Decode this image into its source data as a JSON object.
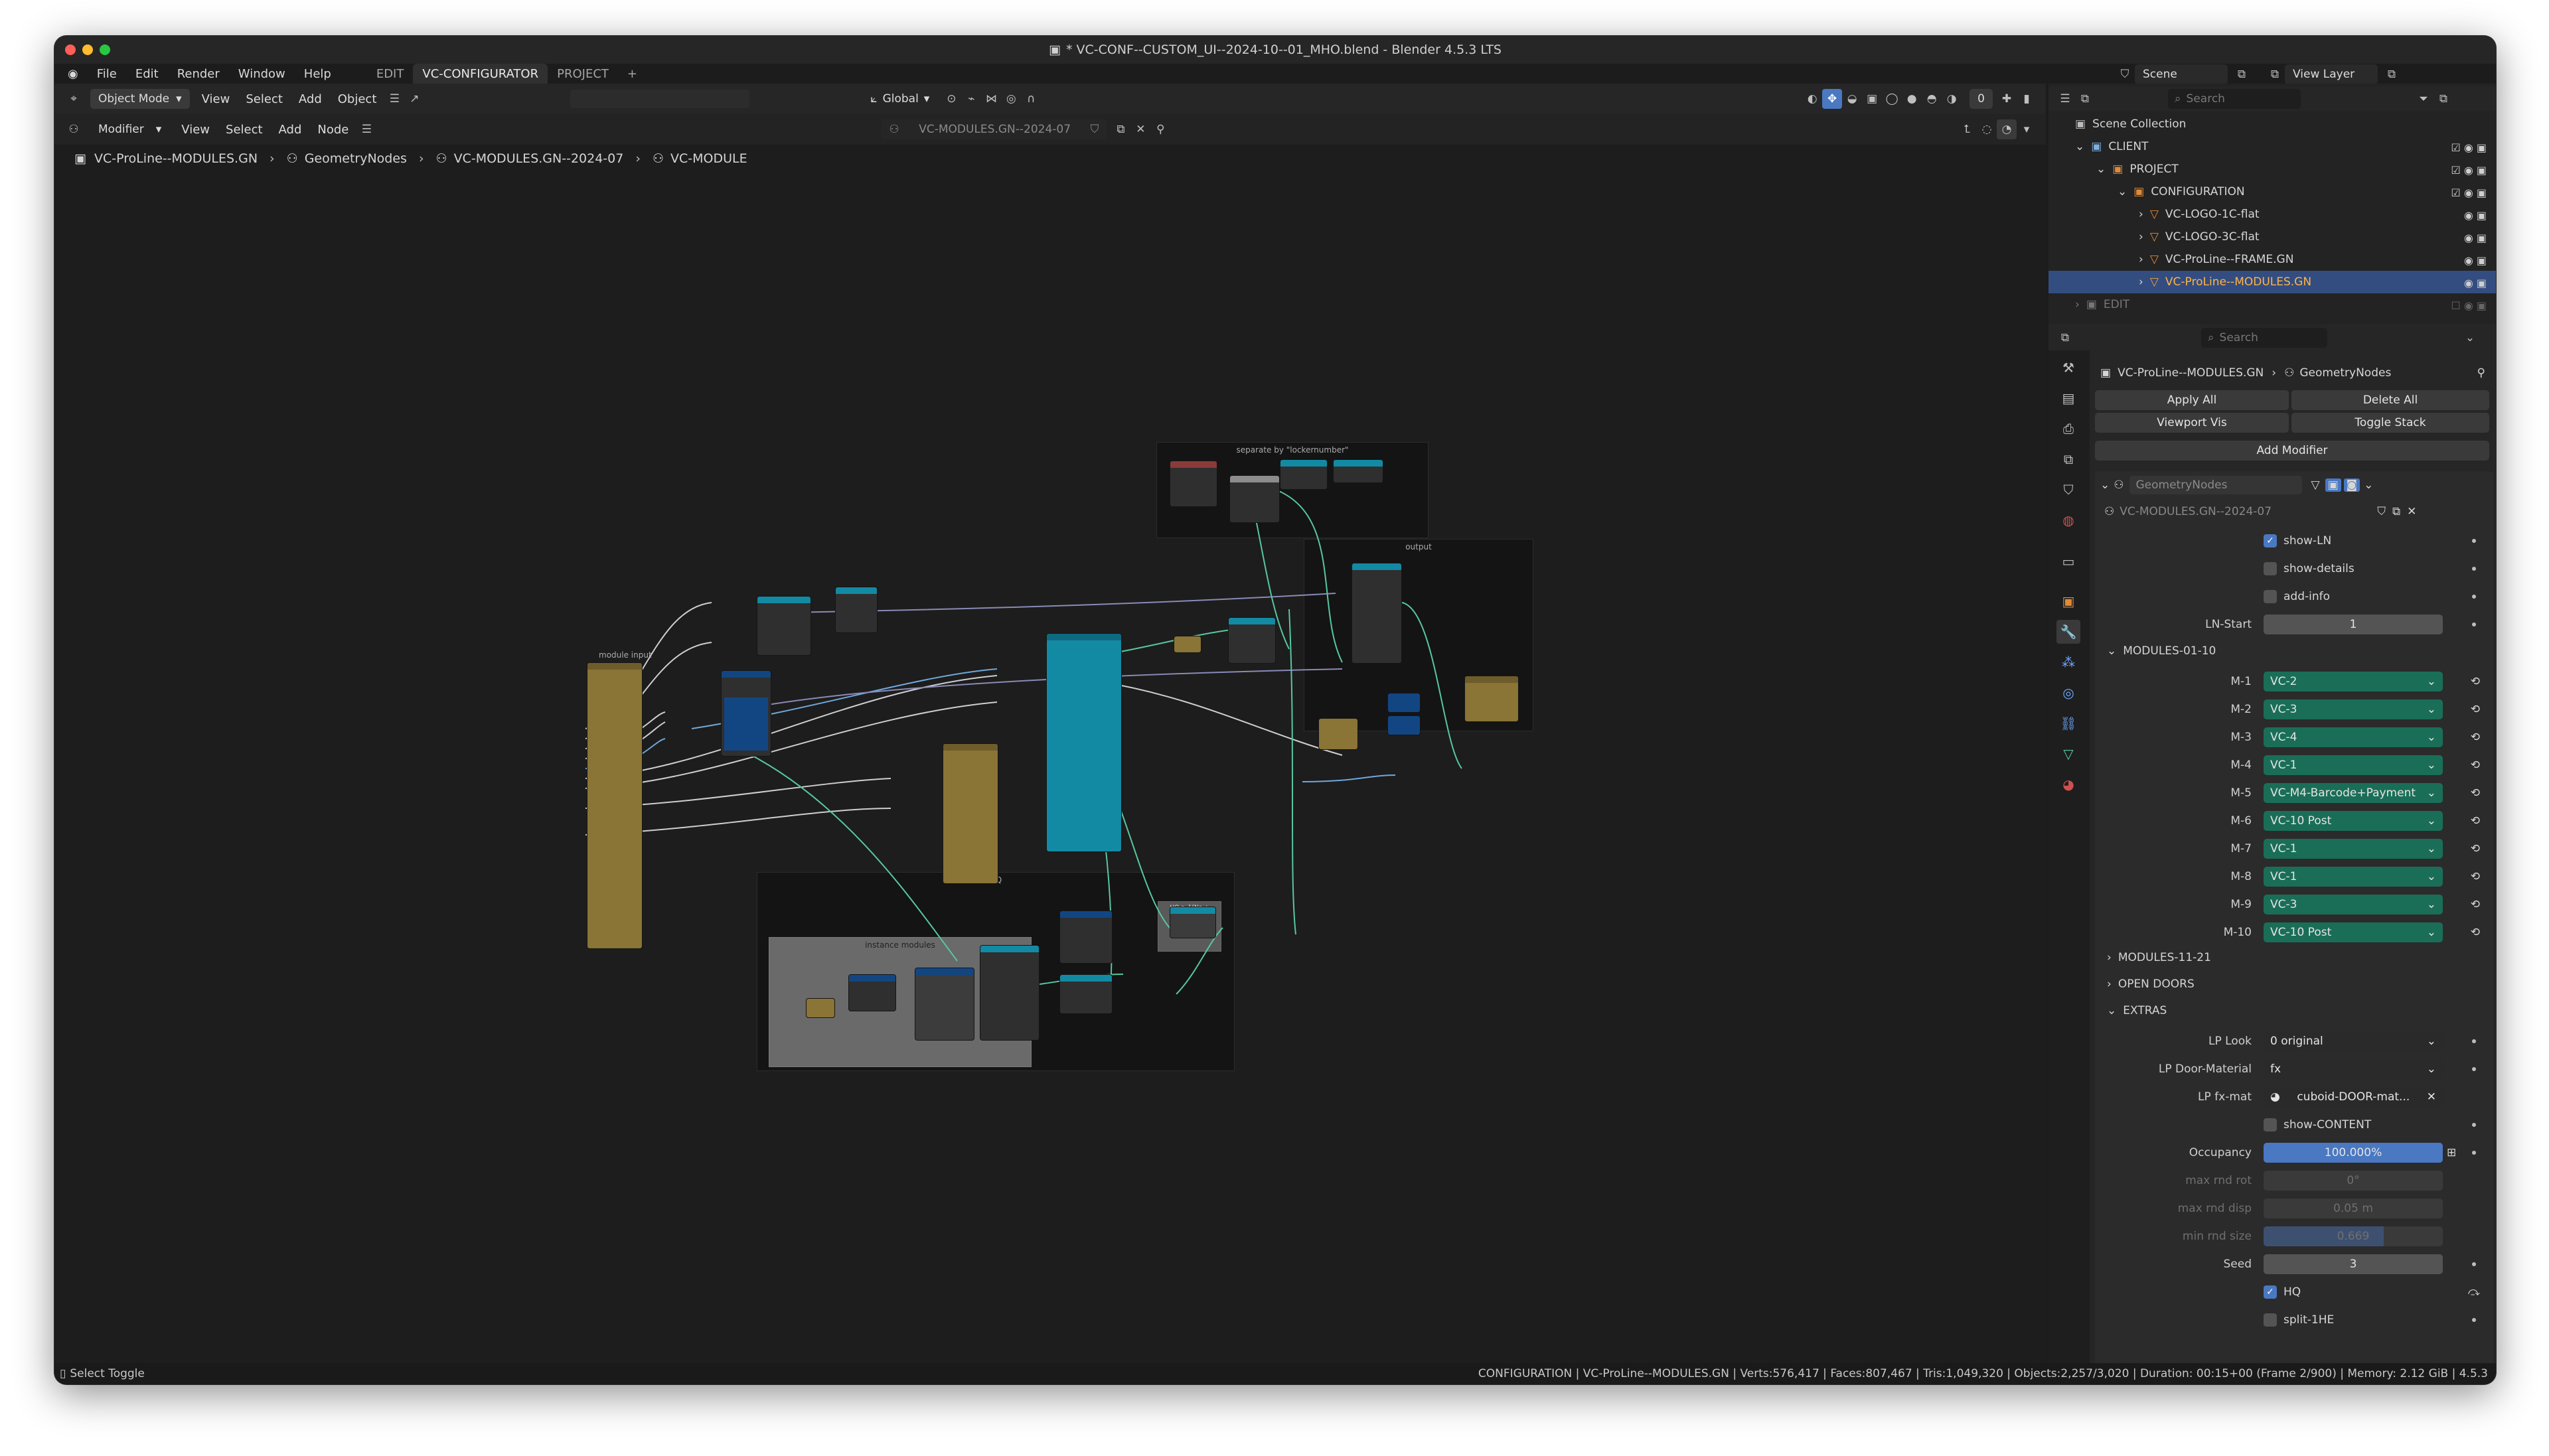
{
  "window": {
    "title": "* VC-CONF--CUSTOM_UI--2024-10--01_MHO.blend - Blender 4.5.3 LTS"
  },
  "menu": {
    "items": [
      "File",
      "Edit",
      "Render",
      "Window",
      "Help"
    ],
    "workspaces": [
      "EDIT",
      "VC-CONFIGURATOR",
      "PROJECT"
    ],
    "add_tab": "+"
  },
  "viewport_header": {
    "mode": "Object Mode",
    "items": [
      "View",
      "Select",
      "Add",
      "Object"
    ],
    "transform": "Global",
    "overlay_count": "0"
  },
  "node_header": {
    "editor": "Modifier",
    "items": [
      "View",
      "Select",
      "Add",
      "Node"
    ],
    "nodegroup": "VC-MODULES.GN--2024-07"
  },
  "breadcrumb": [
    "VC-ProLine--MODULES.GN",
    "GeometryNodes",
    "VC-MODULES.GN--2024-07",
    "VC-MODULE"
  ],
  "node_graph": {
    "frames": {
      "separate": "separate by \"lockernumber\"",
      "output": "output",
      "module_input": "module input",
      "hq": "HQ",
      "instance_modules": "instance modules",
      "hq_switch": "HQ ≥ 1(Ne + switch)"
    }
  },
  "top_right": {
    "scene": "Scene",
    "view_layer": "View Layer"
  },
  "outliner": {
    "search_placeholder": "Search",
    "root": "Scene Collection",
    "rows": [
      {
        "label": "CLIENT",
        "highlight": false
      },
      {
        "label": "PROJECT",
        "highlight": false
      },
      {
        "label": "CONFIGURATION",
        "highlight": false
      },
      {
        "label": "VC-LOGO-1C-flat",
        "highlight": false
      },
      {
        "label": "VC-LOGO-3C-flat",
        "highlight": false
      },
      {
        "label": "VC-ProLine--FRAME.GN",
        "highlight": false
      },
      {
        "label": "VC-ProLine--MODULES.GN",
        "highlight": true
      },
      {
        "label": "EDIT",
        "highlight": false
      }
    ]
  },
  "properties": {
    "search_placeholder": "Search",
    "object": "VC-ProLine--MODULES.GN",
    "modifier_type": "GeometryNodes",
    "apply_all": "Apply All",
    "delete_all": "Delete All",
    "viewport_vis": "Viewport Vis",
    "toggle_stack": "Toggle Stack",
    "add_modifier": "Add Modifier",
    "modifier_name": "GeometryNodes",
    "node_tree": "VC-MODULES.GN--2024-07",
    "show_ln": "show-LN",
    "show_details": "show-details",
    "add_info": "add-info",
    "ln_start_label": "LN-Start",
    "ln_start_value": "1",
    "panel_modules_1": "MODULES-01-10",
    "modules": [
      {
        "label": "M-1",
        "value": "VC-2"
      },
      {
        "label": "M-2",
        "value": "VC-3"
      },
      {
        "label": "M-3",
        "value": "VC-4"
      },
      {
        "label": "M-4",
        "value": "VC-1"
      },
      {
        "label": "M-5",
        "value": "VC-M4-Barcode+Payment"
      },
      {
        "label": "M-6",
        "value": "VC-10 Post"
      },
      {
        "label": "M-7",
        "value": "VC-1"
      },
      {
        "label": "M-8",
        "value": "VC-1"
      },
      {
        "label": "M-9",
        "value": "VC-3"
      },
      {
        "label": "M-10",
        "value": "VC-10 Post"
      }
    ],
    "panel_modules_2": "MODULES-11-21",
    "panel_open_doors": "OPEN DOORS",
    "panel_extras": "EXTRAS",
    "lp_look_label": "LP Look",
    "lp_look_value": "0 original",
    "lp_door_label": "LP Door-Material",
    "lp_door_value": "fx",
    "lp_fx_label": "LP fx-mat",
    "lp_fx_value": "cuboid-DOOR-mat...",
    "show_content": "show-CONTENT",
    "occupancy_label": "Occupancy",
    "occupancy_value": "100.000%",
    "occupancy_fraction": 1.0,
    "max_rnd_rot_label": "max rnd rot",
    "max_rnd_rot_value": "0°",
    "max_rnd_disp_label": "max rnd disp",
    "max_rnd_disp_value": "0.05 m",
    "min_rnd_size_label": "min rnd size",
    "min_rnd_size_value": "0.669",
    "min_rnd_size_fraction": 0.669,
    "seed_label": "Seed",
    "seed_value": "3",
    "hq": "HQ",
    "split": "split-1HE"
  },
  "status": {
    "left": "Select Toggle",
    "right": "CONFIGURATION | VC-ProLine--MODULES.GN | Verts:576,417 | Faces:807,467 | Tris:1,049,320 | Objects:2,257/3,020 | Duration: 00:15+00 (Frame 2/900) | Memory: 2.12 GiB | 4.5.3"
  },
  "colors": {
    "accent": "#4a78c2",
    "enum_teal": "#1a6e57",
    "selected_row": "#334d80",
    "node_olive": "#8a7436",
    "node_teal": "#138aa4",
    "node_navy": "#124683"
  }
}
